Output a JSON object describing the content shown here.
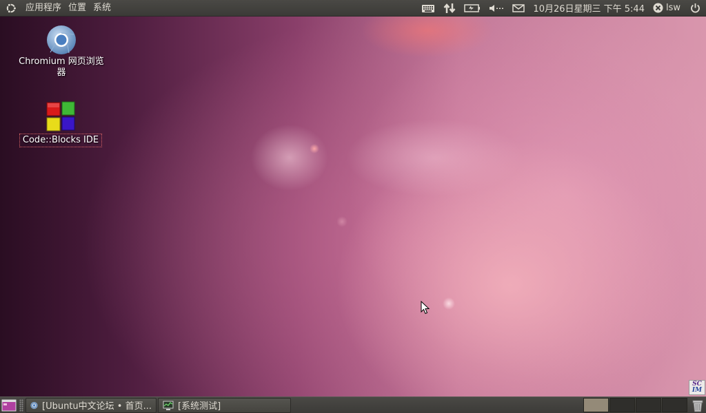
{
  "top_panel": {
    "menus": [
      "应用程序",
      "位置",
      "系统"
    ],
    "clock": "10月26日星期三 下午 5:44",
    "user": "lsw",
    "tray_icons": [
      "keyboard-icon",
      "network-icon",
      "battery-icon",
      "volume-icon",
      "mail-icon"
    ]
  },
  "desktop": {
    "icons": [
      {
        "label": "Chromium 网页浏览器",
        "icon": "chromium-icon"
      },
      {
        "label": "Code::Blocks IDE",
        "icon": "codeblocks-icon"
      }
    ]
  },
  "bottom_panel": {
    "tasks": [
      {
        "label": "[Ubuntu中文论坛 • 首页...",
        "icon": "chromium-icon"
      },
      {
        "label": "[系统测试]",
        "icon": "system-monitor-icon"
      }
    ],
    "workspaces": 4,
    "active_workspace": 1
  },
  "scim": {
    "line1": "SC",
    "line2": "IM"
  },
  "colors": {
    "panel": "#3c3b38",
    "panel_text": "#dfdbd2",
    "wallpaper_dark": "#2a0d22",
    "wallpaper_light": "#d996ad"
  }
}
